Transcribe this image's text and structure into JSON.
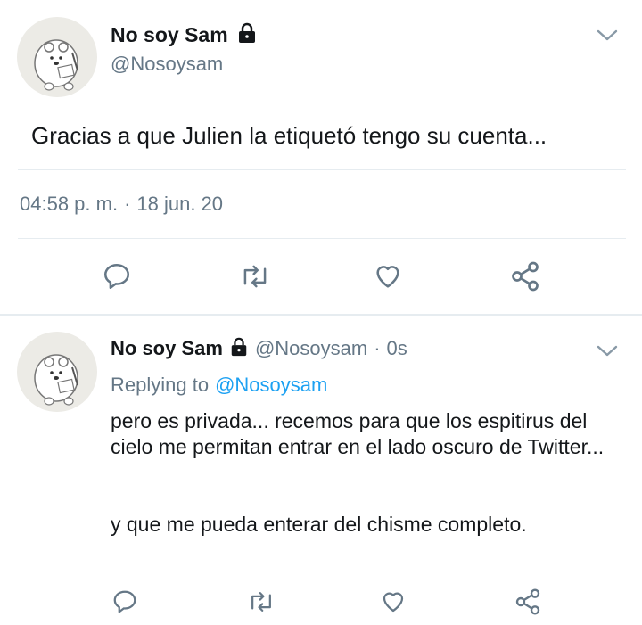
{
  "main_tweet": {
    "display_name": "No soy Sam",
    "handle": "@Nosoysam",
    "text": "Gracias a que Julien la etiquetó tengo su cuenta...",
    "time": "04:58 p. m.",
    "separator": "·",
    "date": "18 jun. 20"
  },
  "reply_tweet": {
    "display_name": "No soy Sam",
    "handle": "@Nosoysam",
    "separator": "·",
    "age": "0s",
    "replying_prefix": "Replying to",
    "replying_handle": "@Nosoysam",
    "paragraph_1": "pero es privada... recemos para que los espitirus del cielo me permitan entrar en el lado oscuro de Twitter...",
    "paragraph_2": "y que me pueda enterar del chisme completo."
  },
  "icons": {
    "lock": "lock-icon",
    "chevron": "chevron-down-icon",
    "reply": "reply-icon",
    "retweet": "retweet-icon",
    "like": "heart-icon",
    "share": "share-icon"
  },
  "colors": {
    "text": "#14171a",
    "secondary": "#657786",
    "link": "#1da1f2",
    "divider": "#e6ecf0",
    "avatar_bg": "#ecebe6"
  }
}
